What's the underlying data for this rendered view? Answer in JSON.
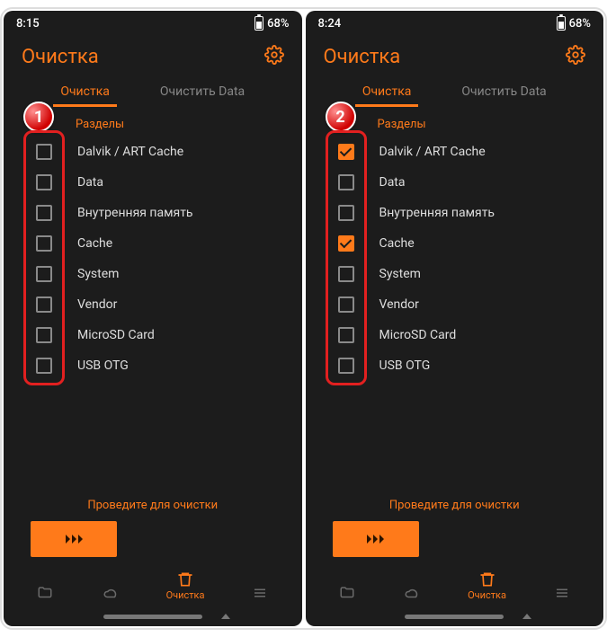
{
  "screens": [
    {
      "time": "8:15",
      "battery": "68%",
      "title": "Очистка",
      "tabs": {
        "active": "Очистка",
        "inactive": "Очистить Data"
      },
      "section": "Разделы",
      "badge": "1",
      "items": [
        {
          "label": "Dalvik / ART Cache",
          "checked": false
        },
        {
          "label": "Data",
          "checked": false
        },
        {
          "label": "Внутренняя память",
          "checked": false
        },
        {
          "label": "Cache",
          "checked": false
        },
        {
          "label": "System",
          "checked": false
        },
        {
          "label": "Vendor",
          "checked": false
        },
        {
          "label": "MicroSD Card",
          "checked": false
        },
        {
          "label": "USB OTG",
          "checked": false
        }
      ],
      "swipe_label": "Проведите для очистки",
      "nav_active_label": "Очистка"
    },
    {
      "time": "8:24",
      "battery": "68%",
      "title": "Очистка",
      "tabs": {
        "active": "Очистка",
        "inactive": "Очистить Data"
      },
      "section": "Разделы",
      "badge": "2",
      "items": [
        {
          "label": "Dalvik / ART Cache",
          "checked": true
        },
        {
          "label": "Data",
          "checked": false
        },
        {
          "label": "Внутренняя память",
          "checked": false
        },
        {
          "label": "Cache",
          "checked": true
        },
        {
          "label": "System",
          "checked": false
        },
        {
          "label": "Vendor",
          "checked": false
        },
        {
          "label": "MicroSD Card",
          "checked": false
        },
        {
          "label": "USB OTG",
          "checked": false
        }
      ],
      "swipe_label": "Проведите для очистки",
      "nav_active_label": "Очистка"
    }
  ]
}
